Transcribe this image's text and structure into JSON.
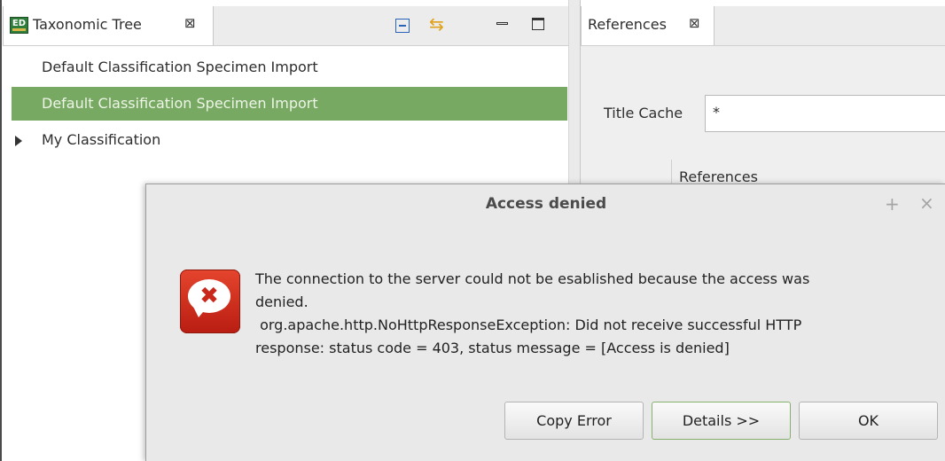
{
  "taxonomic_tree": {
    "tab_title": "Taxonomic Tree",
    "tab_close_glyph": "⊠",
    "logo_text": "ED",
    "items": [
      {
        "label": "Default Classification Specimen Import",
        "selected": false
      },
      {
        "label": "Default Classification Specimen Import",
        "selected": true
      },
      {
        "label": "My Classification",
        "selected": false,
        "expandable": true
      }
    ]
  },
  "references": {
    "tab_title": "References",
    "tab_close_glyph": "⊠",
    "title_cache_label": "Title Cache",
    "title_cache_value": "*",
    "list_label": "References"
  },
  "dialog": {
    "title": "Access denied",
    "message_lines": [
      "The connection to the server could not be esablished because the access was",
      "denied.",
      " org.apache.http.NoHttpResponseException: Did not receive successful HTTP",
      "response: status code = 403, status message = [Access is denied]"
    ],
    "buttons": {
      "copy_error": "Copy Error",
      "details": "Details >>",
      "ok": "OK"
    }
  },
  "colors": {
    "selection": "#77a962",
    "error_icon": "#d7341f"
  }
}
